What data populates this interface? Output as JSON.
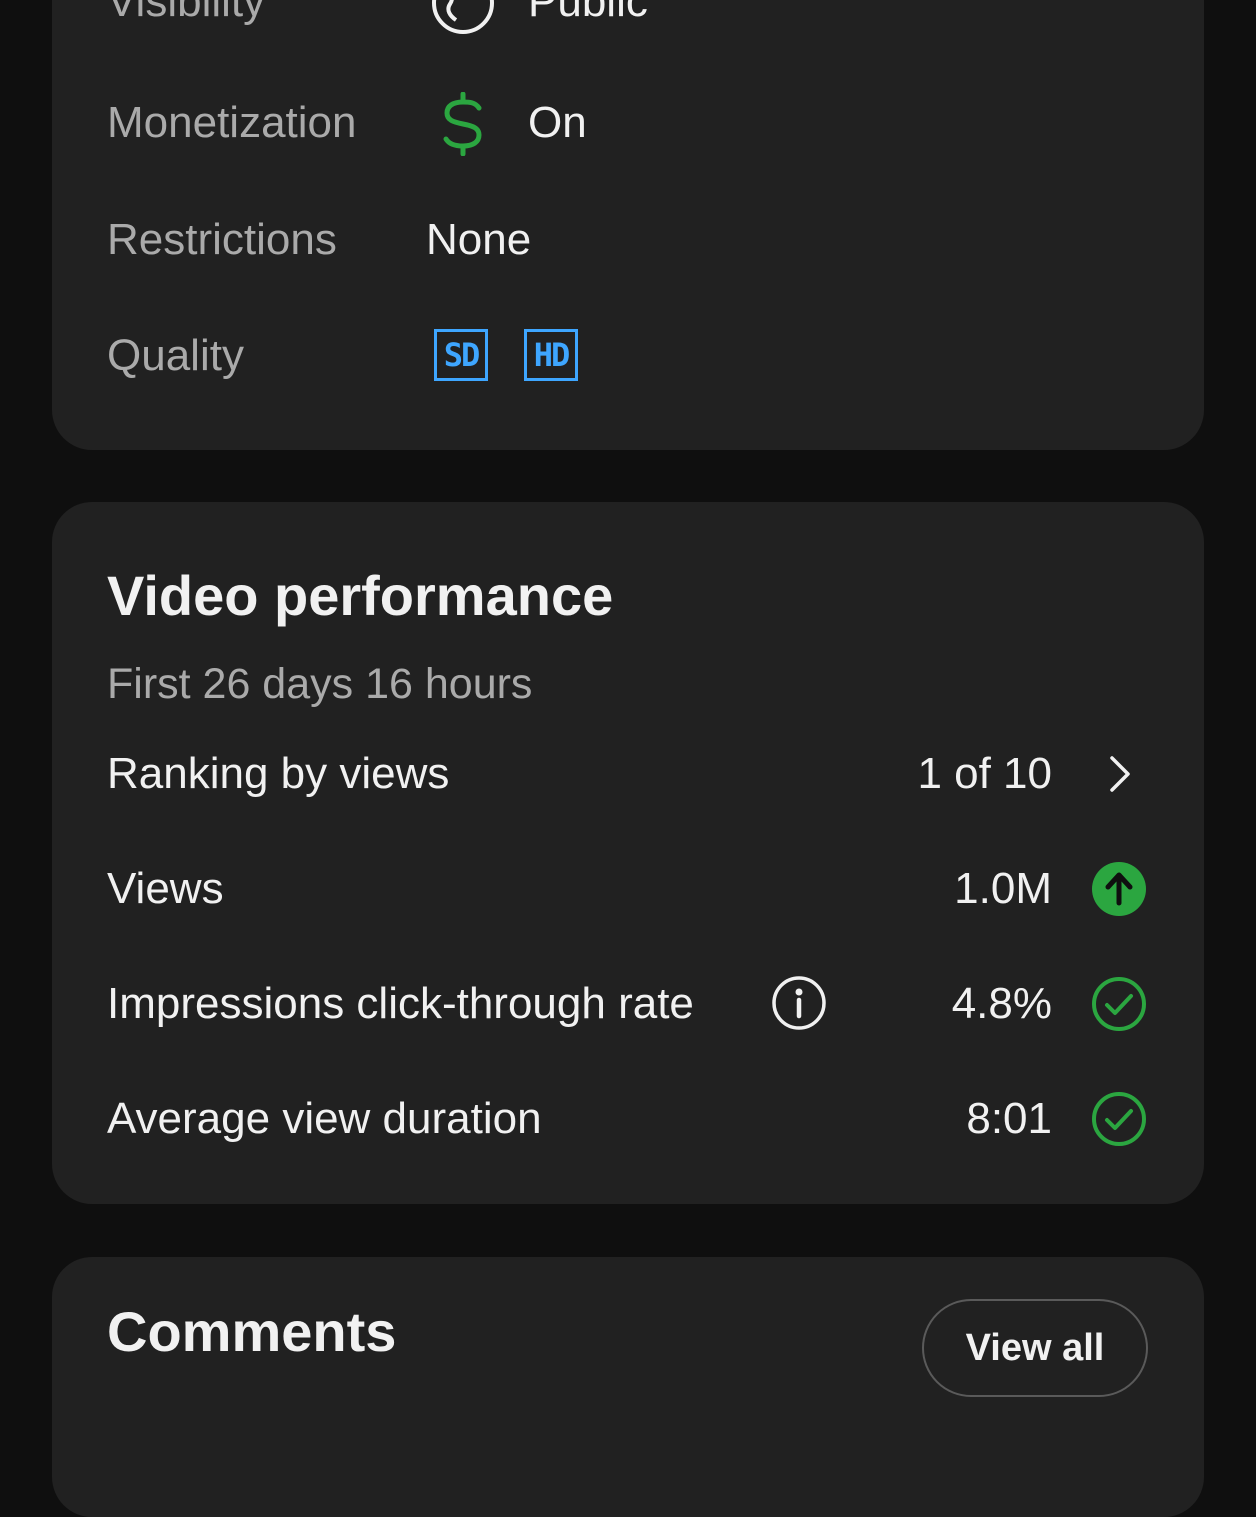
{
  "details": {
    "rows": [
      {
        "label": "Visibility",
        "value": "Public",
        "icon": "globe-icon"
      },
      {
        "label": "Monetization",
        "value": "On",
        "icon": "dollar-icon",
        "icon_color": "#2ba640"
      },
      {
        "label": "Restrictions",
        "value": "None"
      },
      {
        "label": "Quality",
        "badges": [
          "SD",
          "HD"
        ],
        "badge_color": "#3ea6ff"
      }
    ]
  },
  "performance": {
    "title": "Video performance",
    "subtitle": "First 26 days 16 hours",
    "metrics": [
      {
        "label": "Ranking by views",
        "value": "1 of 10",
        "icon": "chevron-right-icon"
      },
      {
        "label": "Views",
        "value": "1.0M",
        "icon": "arrow-up-circle-icon"
      },
      {
        "label": "Impressions click-through rate",
        "value": "4.8%",
        "icon": "check-circle-icon",
        "info_icon": "info-icon"
      },
      {
        "label": "Average view duration",
        "value": "8:01",
        "icon": "check-circle-icon"
      }
    ],
    "status_color": "#2ba640"
  },
  "comments": {
    "title": "Comments",
    "view_all_label": "View all"
  }
}
